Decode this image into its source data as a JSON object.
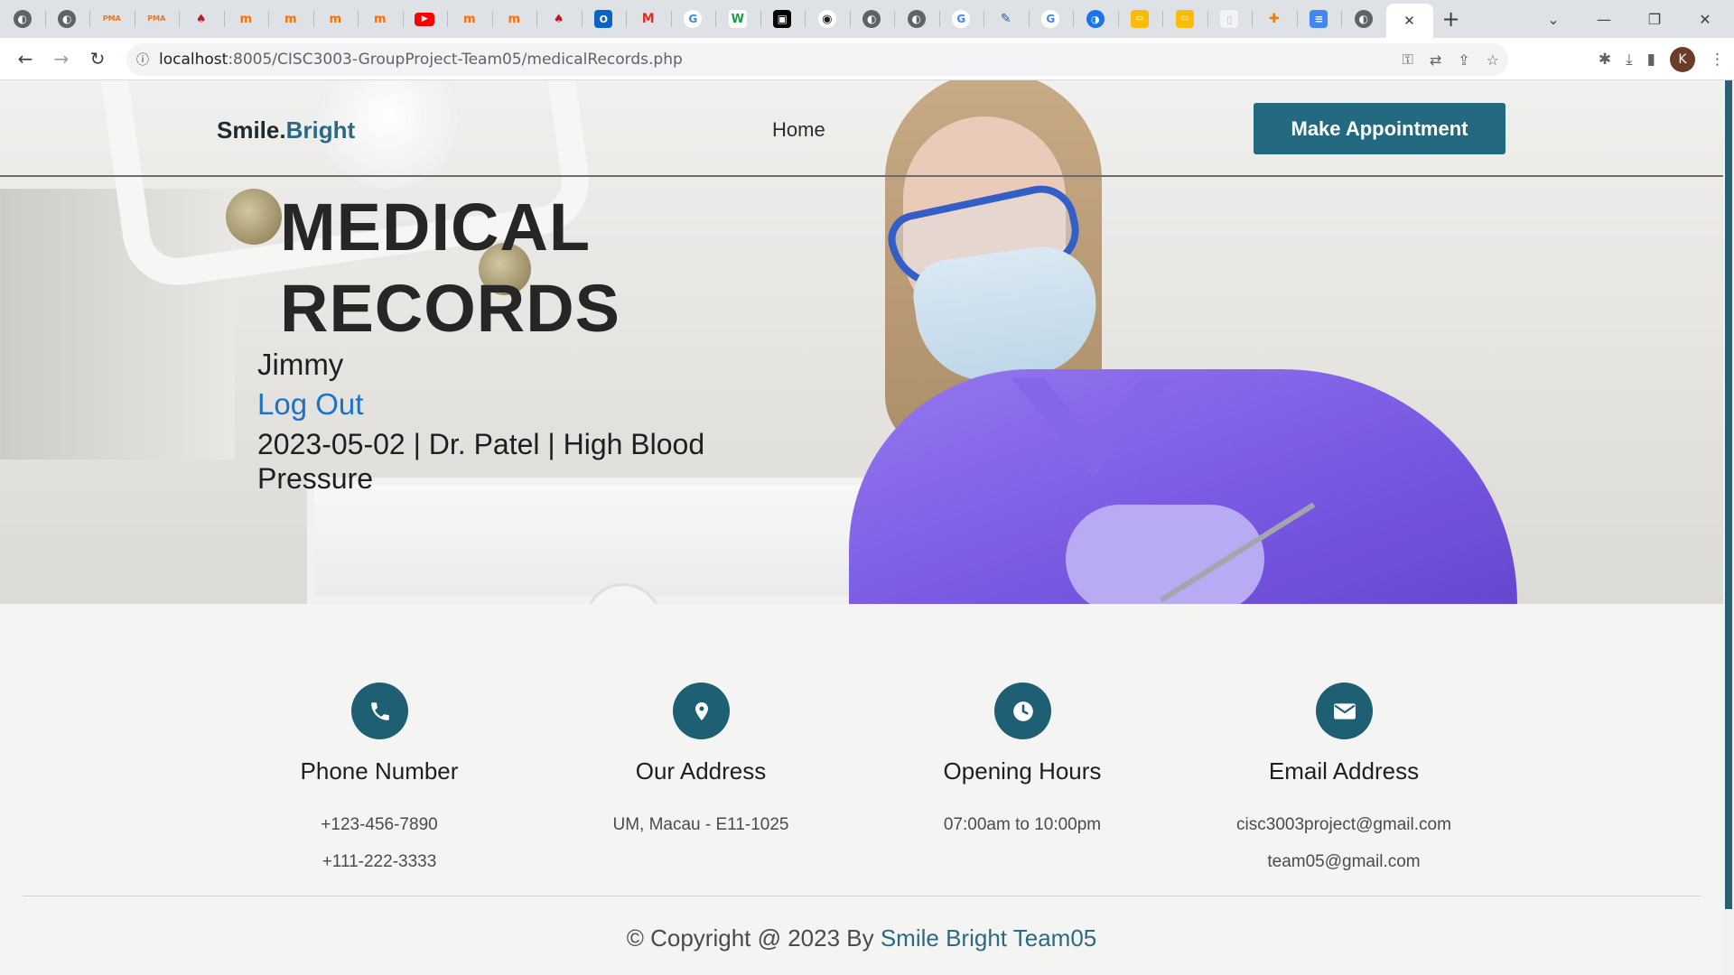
{
  "browser": {
    "tabs": [
      {
        "icon": "globe-icon",
        "glyph": "◐",
        "cls": "globe"
      },
      {
        "icon": "globe-icon",
        "glyph": "◐",
        "cls": "globe"
      },
      {
        "icon": "phpmyadmin-icon",
        "glyph": "PMA",
        "cls": "pma"
      },
      {
        "icon": "phpmyadmin-icon",
        "glyph": "PMA",
        "cls": "pma"
      },
      {
        "icon": "ama-icon",
        "glyph": "♠",
        "cls": "ama"
      },
      {
        "icon": "moodle-icon",
        "glyph": "m",
        "cls": "mm"
      },
      {
        "icon": "moodle-icon",
        "glyph": "m",
        "cls": "mm"
      },
      {
        "icon": "moodle-icon",
        "glyph": "m",
        "cls": "mm"
      },
      {
        "icon": "moodle-icon",
        "glyph": "m",
        "cls": "mm"
      },
      {
        "icon": "youtube-icon",
        "glyph": "▶",
        "cls": "yt"
      },
      {
        "icon": "moodle-icon",
        "glyph": "m",
        "cls": "mm"
      },
      {
        "icon": "moodle-icon",
        "glyph": "m",
        "cls": "mm"
      },
      {
        "icon": "ama-icon",
        "glyph": "♠",
        "cls": "ama"
      },
      {
        "icon": "outlook-icon",
        "glyph": "O",
        "cls": "ol"
      },
      {
        "icon": "gmail-icon",
        "glyph": "M",
        "cls": "gm"
      },
      {
        "icon": "google-icon",
        "glyph": "G",
        "cls": "gg"
      },
      {
        "icon": "w-icon",
        "glyph": "W",
        "cls": "w"
      },
      {
        "icon": "notion-icon",
        "glyph": "▣",
        "cls": "nt"
      },
      {
        "icon": "github-icon",
        "glyph": "◉",
        "cls": "gh"
      },
      {
        "icon": "globe-icon",
        "glyph": "◐",
        "cls": "globe"
      },
      {
        "icon": "globe-icon",
        "glyph": "◐",
        "cls": "globe"
      },
      {
        "icon": "google-icon",
        "glyph": "G",
        "cls": "gg"
      },
      {
        "icon": "pen-icon",
        "glyph": "✎",
        "cls": "pen"
      },
      {
        "icon": "google-icon",
        "glyph": "G",
        "cls": "gg"
      },
      {
        "icon": "edge-icon",
        "glyph": "◑",
        "cls": "blue"
      },
      {
        "icon": "slides-icon",
        "glyph": "▭",
        "cls": "sl"
      },
      {
        "icon": "slides-icon",
        "glyph": "▭",
        "cls": "sl"
      },
      {
        "icon": "blank-page-icon",
        "glyph": "▯",
        "cls": "pale"
      },
      {
        "icon": "bitbucket-icon",
        "glyph": "✚",
        "cls": "bt"
      },
      {
        "icon": "docs-icon",
        "glyph": "≡",
        "cls": "doc"
      },
      {
        "icon": "globe-icon",
        "glyph": "◐",
        "cls": "globe"
      }
    ],
    "active_tab_close": "✕",
    "new_tab": "+",
    "url_host": "localhost",
    "url_path": ":8005/CISC3003-GroupProject-Team05/medicalRecords.php",
    "avatar_initial": "K"
  },
  "site": {
    "logo_main": "Smile.",
    "logo_accent": "Bright",
    "nav_home": "Home",
    "cta_label": "Make Appointment"
  },
  "hero": {
    "title_line1": "MEDICAL",
    "title_line2": "RECORDS",
    "user_name": "Jimmy",
    "logout_label": "Log Out",
    "record_entry": "2023-05-02 | Dr. Patel | High Blood Pressure"
  },
  "info": [
    {
      "icon": "phone-icon",
      "title": "Phone Number",
      "lines": [
        "+123-456-7890",
        "+111-222-3333"
      ]
    },
    {
      "icon": "location-pin-icon",
      "title": "Our Address",
      "lines": [
        "UM, Macau - E11-1025"
      ]
    },
    {
      "icon": "clock-icon",
      "title": "Opening Hours",
      "lines": [
        "07:00am to 10:00pm"
      ]
    },
    {
      "icon": "envelope-icon",
      "title": "Email Address",
      "lines": [
        "cisc3003project@gmail.com",
        "team05@gmail.com"
      ]
    }
  ],
  "footer": {
    "copyright_prefix": "© Copyright @ 2023 By ",
    "team_name": "Smile Bright Team05"
  },
  "colors": {
    "accent": "#236a80",
    "link": "#1a73c8",
    "icon_circle": "#1f5f73",
    "scrubs": "#6a46dd"
  }
}
